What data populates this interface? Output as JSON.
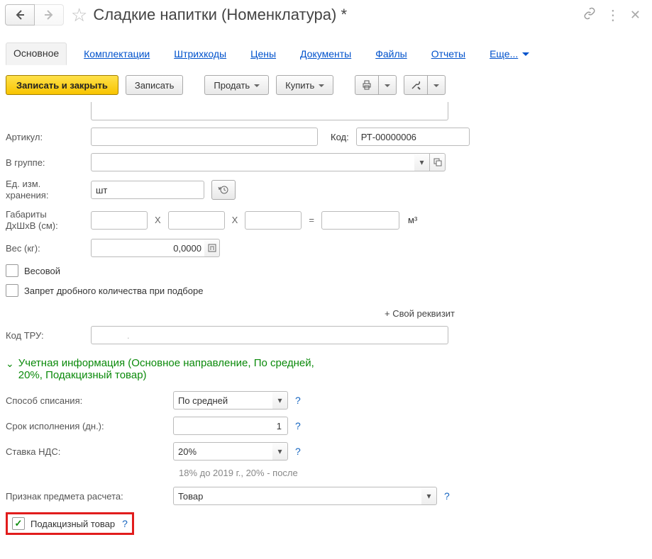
{
  "header": {
    "title": "Сладкие напитки (Номенклатура) *"
  },
  "tabs": {
    "main": "Основное",
    "kits": "Комплектации",
    "barcodes": "Штрихкоды",
    "prices": "Цены",
    "docs": "Документы",
    "files": "Файлы",
    "reports": "Отчеты",
    "more": "Еще..."
  },
  "toolbar": {
    "save_close": "Записать и закрыть",
    "save": "Записать",
    "sell": "Продать",
    "buy": "Купить"
  },
  "form": {
    "sku_label": "Артикул:",
    "code_label": "Код:",
    "code_value": "РТ-00000006",
    "group_label": "В группе:",
    "uom_label_l1": "Ед. изм.",
    "uom_label_l2": "хранения:",
    "uom_value": "шт",
    "dims_label_l1": "Габариты",
    "dims_label_l2": "ДхШхВ (см):",
    "dims_x": "X",
    "dims_eq": "=",
    "dims_unit": "м³",
    "weight_label": "Вес (кг):",
    "weight_value": "0,0000",
    "weighted": "Весовой",
    "no_fraction": "Запрет дробного количества при подборе",
    "add_prop": "+ Свой реквизит",
    "tru_label": "Код ТРУ:",
    "tru_value": "."
  },
  "section": {
    "title_l1": "Учетная информация (Основное направление, По средней,",
    "title_l2": "20%, Подакцизный товар)"
  },
  "accounting": {
    "writeoff_label": "Способ списания:",
    "writeoff_value": "По средней",
    "duration_label": "Срок исполнения (дн.):",
    "duration_value": "1",
    "vat_label": "Ставка НДС:",
    "vat_value": "20%",
    "vat_hint": "18% до 2019 г., 20% - после",
    "subject_label": "Признак предмета расчета:",
    "subject_value": "Товар",
    "excise_label": "Подакцизный товар",
    "help": "?"
  }
}
